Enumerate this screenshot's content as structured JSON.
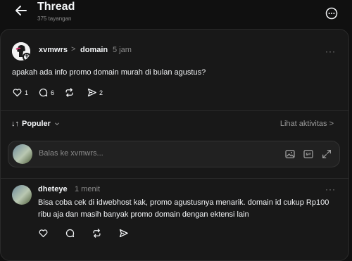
{
  "header": {
    "title": "Thread",
    "views": "375 tayangan"
  },
  "post": {
    "username": "xvmwrs",
    "separator": ">",
    "category": "domain",
    "time": "5 jam",
    "more": "···",
    "body": "apakah ada info promo domain murah di bulan agustus?",
    "likes": "1",
    "comments": "6",
    "shares": "2"
  },
  "sort": {
    "label": "Populer",
    "prefix": "↓↑",
    "activity": "Lihat aktivitas >"
  },
  "reply_box": {
    "placeholder": "Balas ke xvmwrs..."
  },
  "comment": {
    "username": "dheteye",
    "time": "1 menit",
    "more": "···",
    "body": "Bisa coba cek di idwebhost kak, promo agustusnya menarik. domain id cukup Rp100 ribu aja dan masih banyak promo domain dengan ektensi lain"
  }
}
